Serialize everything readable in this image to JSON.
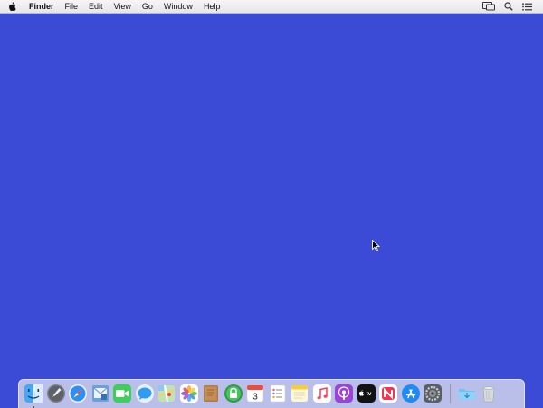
{
  "menubar": {
    "apple_icon": "apple-logo-icon",
    "items": [
      "Finder",
      "File",
      "Edit",
      "View",
      "Go",
      "Window",
      "Help"
    ],
    "status_icons": [
      "display-mirroring-icon",
      "spotlight-search-icon",
      "notification-center-icon"
    ]
  },
  "desktop": {
    "background_color": "#3b4bd6",
    "pointer": "arrow-cursor-icon"
  },
  "dock": {
    "apps": [
      {
        "icon": "finder-icon",
        "running": true
      },
      {
        "icon": "launchpad-icon"
      },
      {
        "icon": "safari-icon"
      },
      {
        "icon": "mail-icon"
      },
      {
        "icon": "facetime-icon"
      },
      {
        "icon": "messages-icon"
      },
      {
        "icon": "maps-icon"
      },
      {
        "icon": "photos-icon"
      },
      {
        "icon": "notefile-icon"
      },
      {
        "icon": "lock-app-icon"
      },
      {
        "icon": "calendar-icon",
        "day": "3"
      },
      {
        "icon": "reminders-icon"
      },
      {
        "icon": "notes-icon"
      },
      {
        "icon": "music-icon"
      },
      {
        "icon": "podcasts-icon"
      },
      {
        "icon": "apple-tv-icon",
        "label": "tv"
      },
      {
        "icon": "news-icon"
      },
      {
        "icon": "app-store-icon"
      },
      {
        "icon": "system-preferences-icon"
      }
    ],
    "others": [
      {
        "icon": "downloads-folder-icon"
      },
      {
        "icon": "trash-icon"
      }
    ]
  }
}
